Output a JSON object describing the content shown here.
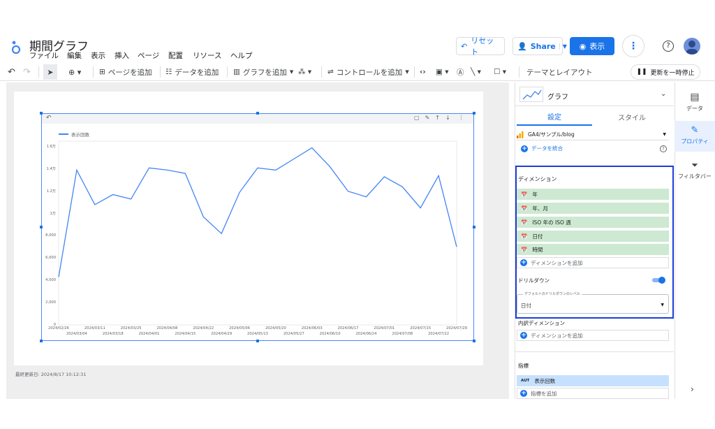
{
  "app": {
    "title": "期間グラフ",
    "menu": [
      "ファイル",
      "編集",
      "表示",
      "挿入",
      "ページ",
      "配置",
      "リソース",
      "ヘルプ"
    ],
    "reset_label": "リセット",
    "share_label": "Share",
    "view_label": "表示"
  },
  "toolbar": {
    "add_page": "ページを追加",
    "add_data": "データを追加",
    "add_chart": "グラフを追加",
    "add_control": "コントロールを追加",
    "theme_layout": "テーマとレイアウト",
    "pause_update": "更新を一時停止"
  },
  "chart_data": {
    "type": "line",
    "legend": "表示回数",
    "y_ticks": [
      "1.6万",
      "1.4万",
      "1.2万",
      "1万",
      "8,000",
      "6,000",
      "4,000",
      "2,000",
      "0"
    ],
    "ylim": [
      0,
      16500
    ],
    "x_ticks_top": [
      "2024/02/26",
      "2024/03/11",
      "2024/03/25",
      "2024/04/08",
      "2024/04/22",
      "2024/05/06",
      "2024/05/20",
      "2024/06/03",
      "2024/06/17",
      "2024/07/01",
      "2024/07/15",
      "2024/07/29"
    ],
    "x_ticks_bottom": [
      "2024/03/04",
      "2024/03/18",
      "2024/04/01",
      "2024/04/15",
      "2024/04/29",
      "2024/05/13",
      "2024/05/27",
      "2024/06/10",
      "2024/06/24",
      "2024/07/08",
      "2024/07/22"
    ],
    "x": [
      "2024/02/26",
      "2024/03/04",
      "2024/03/11",
      "2024/03/18",
      "2024/03/25",
      "2024/04/01",
      "2024/04/08",
      "2024/04/15",
      "2024/04/22",
      "2024/04/29",
      "2024/05/06",
      "2024/05/13",
      "2024/05/20",
      "2024/05/27",
      "2024/06/03",
      "2024/06/10",
      "2024/06/17",
      "2024/06/24",
      "2024/07/01",
      "2024/07/08",
      "2024/07/15",
      "2024/07/22",
      "2024/07/29"
    ],
    "series": [
      {
        "name": "表示回数",
        "color": "#4285f4",
        "values": [
          4300,
          13900,
          10800,
          11700,
          11300,
          14100,
          13900,
          13600,
          9700,
          8200,
          11900,
          14100,
          13900,
          14900,
          15900,
          14200,
          12000,
          11500,
          13300,
          12400,
          10500,
          13400,
          7000
        ]
      }
    ]
  },
  "footer": {
    "updated": "最終更新日: 2024/8/17 10:12:31"
  },
  "panel": {
    "title": "グラフ",
    "tab_setup": "設定",
    "tab_style": "スタイル",
    "datasource": "GA4/サンプル/blog",
    "blend": "データを統合",
    "dimension_title": "ディメンション",
    "dimensions": [
      "年",
      "年、月",
      "ISO 年の ISO 週",
      "日付",
      "時間"
    ],
    "add_dimension": "ディメンションを追加",
    "drilldown": "ドリルダウン",
    "drill_level_label": "デフォルトのドリルダウンのレベル",
    "drill_level_value": "日付",
    "breakdown_title": "内訳ディメンション",
    "add_breakdown": "ディメンションを追加",
    "metric_title": "指標",
    "metric_tag": "AUT",
    "metric": "表示回数",
    "add_metric": "指標を追加"
  },
  "rail": {
    "data": "データ",
    "properties": "プロパティ",
    "filter": "フィルタバー"
  },
  "colors": {
    "accent": "#1a73e8",
    "chip_green": "#cde9d1",
    "chip_blue": "#c6e1ff",
    "highlight": "#1c3ed6"
  }
}
